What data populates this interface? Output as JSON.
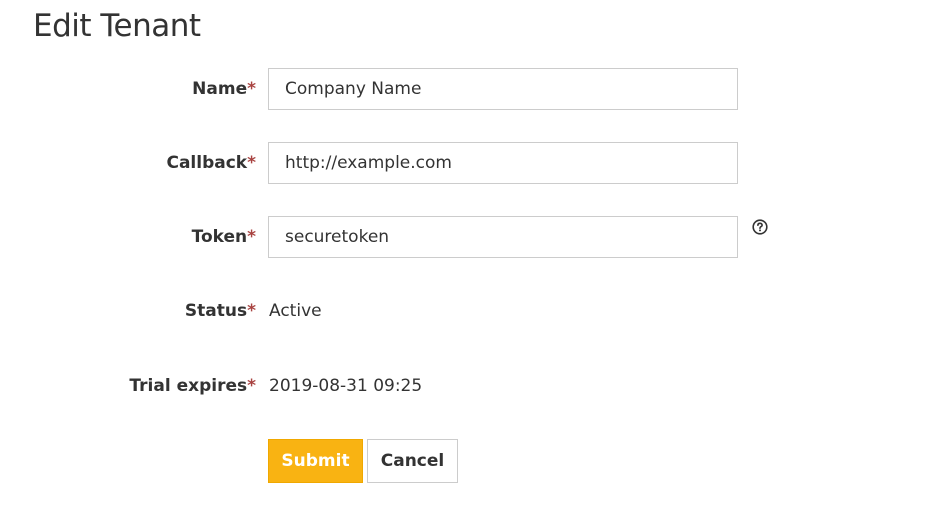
{
  "page": {
    "title": "Edit Tenant"
  },
  "form": {
    "required_marker": "*",
    "name": {
      "label": "Name",
      "value": "Company Name"
    },
    "callback": {
      "label": "Callback",
      "value": "http://example.com"
    },
    "token": {
      "label": "Token",
      "value": "securetoken",
      "help_icon": "question-circle-icon"
    },
    "status": {
      "label": "Status",
      "value": "Active"
    },
    "trial_expires": {
      "label": "Trial expires",
      "value": "2019-08-31 09:25"
    }
  },
  "actions": {
    "submit_label": "Submit",
    "cancel_label": "Cancel"
  },
  "colors": {
    "accent": "#f9b312",
    "required": "#a94442",
    "text": "#333333",
    "border": "#cccccc"
  }
}
